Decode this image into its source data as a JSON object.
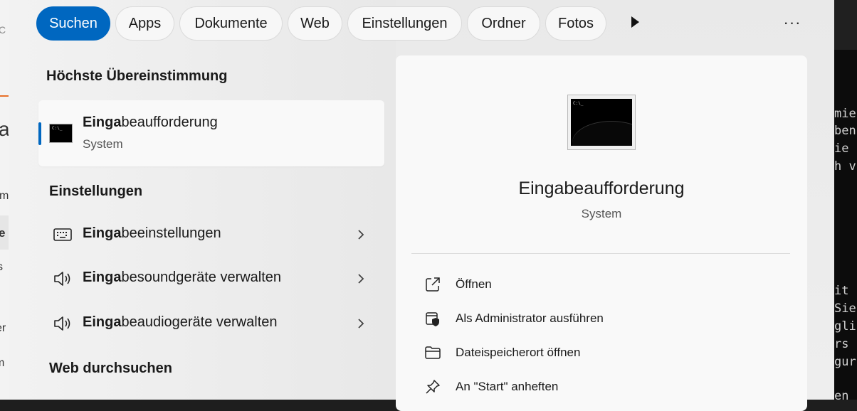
{
  "background_left": {
    "fragments": [
      "C",
      "a",
      "m",
      "e",
      "s",
      "er",
      "m"
    ]
  },
  "background_right": {
    "lines": [
      "mie",
      "ben",
      "ie",
      "h v",
      "it",
      "Sie",
      "gli",
      "rs",
      "gur",
      "en"
    ]
  },
  "tabs": [
    {
      "label": "Suchen",
      "active": true
    },
    {
      "label": "Apps",
      "active": false
    },
    {
      "label": "Dokumente",
      "active": false
    },
    {
      "label": "Web",
      "active": false
    },
    {
      "label": "Einstellungen",
      "active": false
    },
    {
      "label": "Ordner",
      "active": false
    },
    {
      "label": "Fotos",
      "active": false
    }
  ],
  "more_tabs_icon": "play-triangle-icon",
  "overflow_label": "···",
  "best_match": {
    "heading": "Höchste Übereinstimmung",
    "title_match": "Einga",
    "title_rest": "beaufforderung",
    "subtitle": "System",
    "icon": "command-prompt-icon"
  },
  "settings": {
    "heading": "Einstellungen",
    "items": [
      {
        "match": "Einga",
        "rest": "beeinstellungen",
        "icon": "keyboard-icon"
      },
      {
        "match": "Einga",
        "rest": "besoundgeräte verwalten",
        "icon": "speaker-icon"
      },
      {
        "match": "Einga",
        "rest": "beaudiogeräte verwalten",
        "icon": "speaker-icon"
      }
    ]
  },
  "web": {
    "heading": "Web durchsuchen"
  },
  "detail": {
    "title": "Eingabeaufforderung",
    "subtitle": "System",
    "icon_caption": "C:\\_",
    "actions": [
      {
        "label": "Öffnen",
        "icon": "open-external-icon"
      },
      {
        "label": "Als Administrator ausführen",
        "icon": "admin-shield-icon"
      },
      {
        "label": "Dateispeicherort öffnen",
        "icon": "folder-icon"
      },
      {
        "label": "An \"Start\" anheften",
        "icon": "pin-icon"
      }
    ]
  },
  "colors": {
    "accent": "#0067c0",
    "pane": "#f9f9f9",
    "flyout": "#ebebeb"
  }
}
